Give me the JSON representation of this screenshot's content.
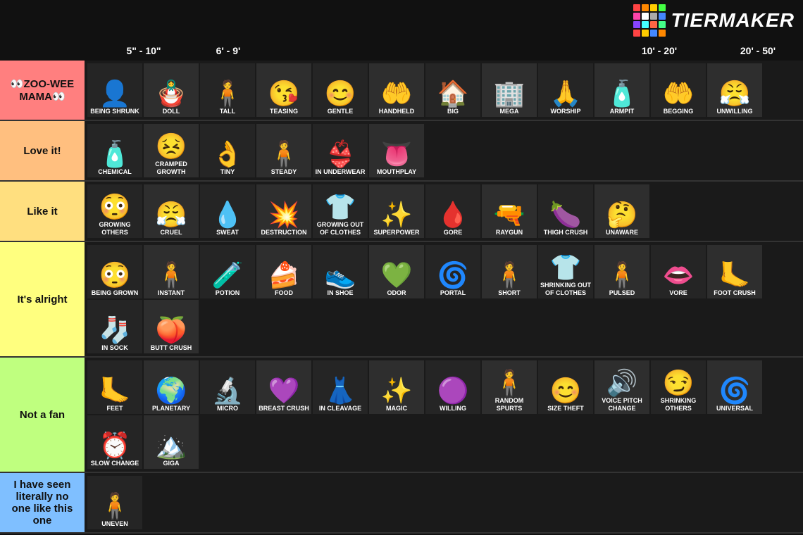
{
  "header": {
    "logo_text": "TiERMAKER",
    "logo_colors": [
      "#ff4444",
      "#ff8800",
      "#ffcc00",
      "#44ff44",
      "#4488ff",
      "#8844ff",
      "#ff44aa",
      "#44ffff",
      "#ffffff",
      "#aaaaaa",
      "#ff6644",
      "#44ff88"
    ]
  },
  "size_header": {
    "sizes": [
      "5\" - 10\"",
      "6' - 9'",
      "",
      "",
      "",
      "10' - 20'",
      "20' - 50'"
    ]
  },
  "tiers": [
    {
      "id": "s",
      "label": "👀ZOO-WEE MAMA👀",
      "color": "#ff7f7f",
      "items": [
        {
          "emoji": "👤",
          "label": "Being Shrunk"
        },
        {
          "emoji": "🪆",
          "label": "DOLL"
        },
        {
          "emoji": "🧍",
          "label": "TALL"
        },
        {
          "emoji": "😘",
          "label": "TEASING"
        },
        {
          "emoji": "😊",
          "label": "GENTLE"
        },
        {
          "emoji": "🤲",
          "label": "HANDHELD"
        },
        {
          "emoji": "🏠",
          "label": "BIG"
        },
        {
          "emoji": "🏢",
          "label": "MEGA"
        },
        {
          "emoji": "🙏",
          "label": "WORSHIP"
        },
        {
          "emoji": "🧴",
          "label": "ARMPIT"
        },
        {
          "emoji": "🤲",
          "label": "BEGGING"
        },
        {
          "emoji": "😤",
          "label": "UNWILLING"
        }
      ]
    },
    {
      "id": "a",
      "label": "Love it!",
      "color": "#ffbf7f",
      "items": [
        {
          "emoji": "🧴",
          "label": "CHEMICAL"
        },
        {
          "emoji": "😣",
          "label": "Cramped Growth"
        },
        {
          "emoji": "👌",
          "label": "TINY"
        },
        {
          "emoji": "🧍",
          "label": "STEADY"
        },
        {
          "emoji": "👙",
          "label": "IN UNDERWEAR"
        },
        {
          "emoji": "👅",
          "label": "MOUTHPLAY"
        }
      ]
    },
    {
      "id": "b",
      "label": "Like it",
      "color": "#ffdf7f",
      "items": [
        {
          "emoji": "😳",
          "label": "Growing Others"
        },
        {
          "emoji": "😤",
          "label": "CRUEL"
        },
        {
          "emoji": "💧",
          "label": "SWEAT"
        },
        {
          "emoji": "💥",
          "label": "DESTRUCTION"
        },
        {
          "emoji": "👕",
          "label": "Growing out of Clothes"
        },
        {
          "emoji": "✨",
          "label": "SUPERPOWER"
        },
        {
          "emoji": "🩸",
          "label": "GORE"
        },
        {
          "emoji": "🔫",
          "label": "RAYGUN"
        },
        {
          "emoji": "🍆",
          "label": "THIGH CRUSH"
        },
        {
          "emoji": "🤔",
          "label": "UNAWARE"
        }
      ]
    },
    {
      "id": "c",
      "label": "It's alright",
      "color": "#ffff7f",
      "items": [
        {
          "emoji": "😳",
          "label": "Being Grown"
        },
        {
          "emoji": "🧍",
          "label": "INSTANT"
        },
        {
          "emoji": "🧪",
          "label": "POTION"
        },
        {
          "emoji": "🍰",
          "label": "FOOD"
        },
        {
          "emoji": "👟",
          "label": "IN SHOE"
        },
        {
          "emoji": "💚",
          "label": "ODOR"
        },
        {
          "emoji": "🌀",
          "label": "PORTAL"
        },
        {
          "emoji": "🧍",
          "label": "SHORT"
        },
        {
          "emoji": "👕",
          "label": "Shrinking out of Clothes"
        },
        {
          "emoji": "🧍",
          "label": "PULSED"
        },
        {
          "emoji": "👄",
          "label": "VORE"
        },
        {
          "emoji": "🦶",
          "label": "FOOT CRUSH"
        },
        {
          "emoji": "🧦",
          "label": "IN SOCK"
        },
        {
          "emoji": "🍑",
          "label": "BUTT CRUSH"
        }
      ]
    },
    {
      "id": "d",
      "label": "Not a fan",
      "color": "#bfff7f",
      "items": [
        {
          "emoji": "🦶",
          "label": "FEET"
        },
        {
          "emoji": "🌍",
          "label": "PLANETARY"
        },
        {
          "emoji": "🔬",
          "label": "MICRO"
        },
        {
          "emoji": "💜",
          "label": "BREAST CRUSH"
        },
        {
          "emoji": "👗",
          "label": "IN CLEAVAGE"
        },
        {
          "emoji": "✨",
          "label": "MAGIC"
        },
        {
          "emoji": "🟣",
          "label": "WILLING"
        },
        {
          "emoji": "🧍",
          "label": "Random Spurts"
        },
        {
          "emoji": "😊",
          "label": "SIZE THEFT"
        },
        {
          "emoji": "🔊",
          "label": "Voice Pitch Change"
        },
        {
          "emoji": "😏",
          "label": "Shrinking Others"
        },
        {
          "emoji": "🌀",
          "label": "UNIVERSAL"
        },
        {
          "emoji": "⏰",
          "label": "SLOW CHANGE"
        },
        {
          "emoji": "🏔️",
          "label": "GIGA"
        }
      ]
    },
    {
      "id": "f",
      "label": "I have seen literally no one like this one",
      "color": "#7fbfff",
      "items": [
        {
          "emoji": "🧍",
          "label": "UNEVEN"
        }
      ]
    }
  ]
}
